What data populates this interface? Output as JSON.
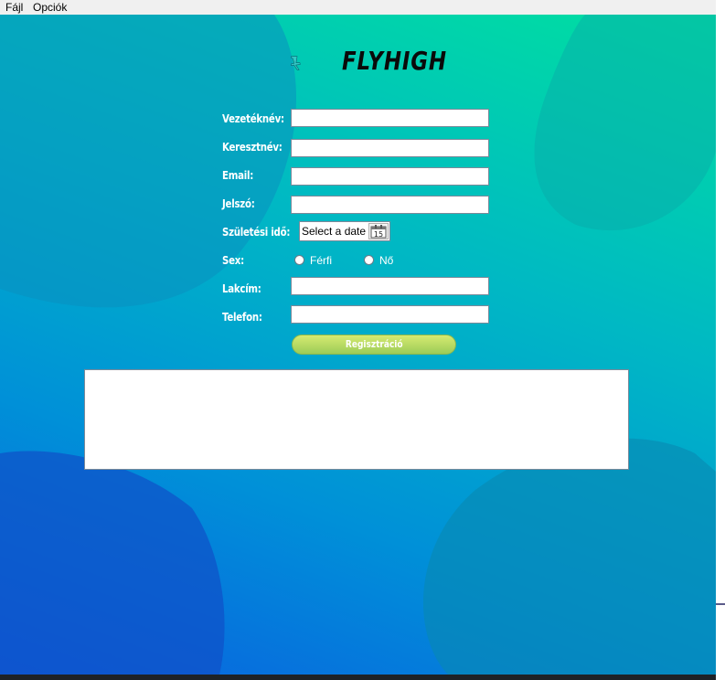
{
  "menubar": {
    "items": [
      {
        "label": "Fájl"
      },
      {
        "label": "Opciók"
      }
    ]
  },
  "logo": {
    "text": "FLYHIGH",
    "icon": "plane-icon"
  },
  "form": {
    "last_name_label": "Vezetéknév:",
    "first_name_label": "Keresztnév:",
    "email_label": "Email:",
    "password_label": "Jelszó:",
    "birthdate_label": "Születési idő:",
    "birthdate_placeholder": "Select a date",
    "calendar_day": "15",
    "sex_label": "Sex:",
    "sex_options": [
      "Férfi",
      "Nő"
    ],
    "address_label": "Lakcím:",
    "phone_label": "Telefon:",
    "fields": {
      "last_name": "",
      "first_name": "",
      "email": "",
      "password": "",
      "address": "",
      "phone": ""
    },
    "submit_label": "Regisztráció"
  },
  "output": {
    "text": ""
  },
  "colors": {
    "background_top": "#00e0a0",
    "background_bottom": "#0a60e0",
    "button": "#b8dc62",
    "logo": "#0a0a0a",
    "plane": "#30c8c8"
  }
}
